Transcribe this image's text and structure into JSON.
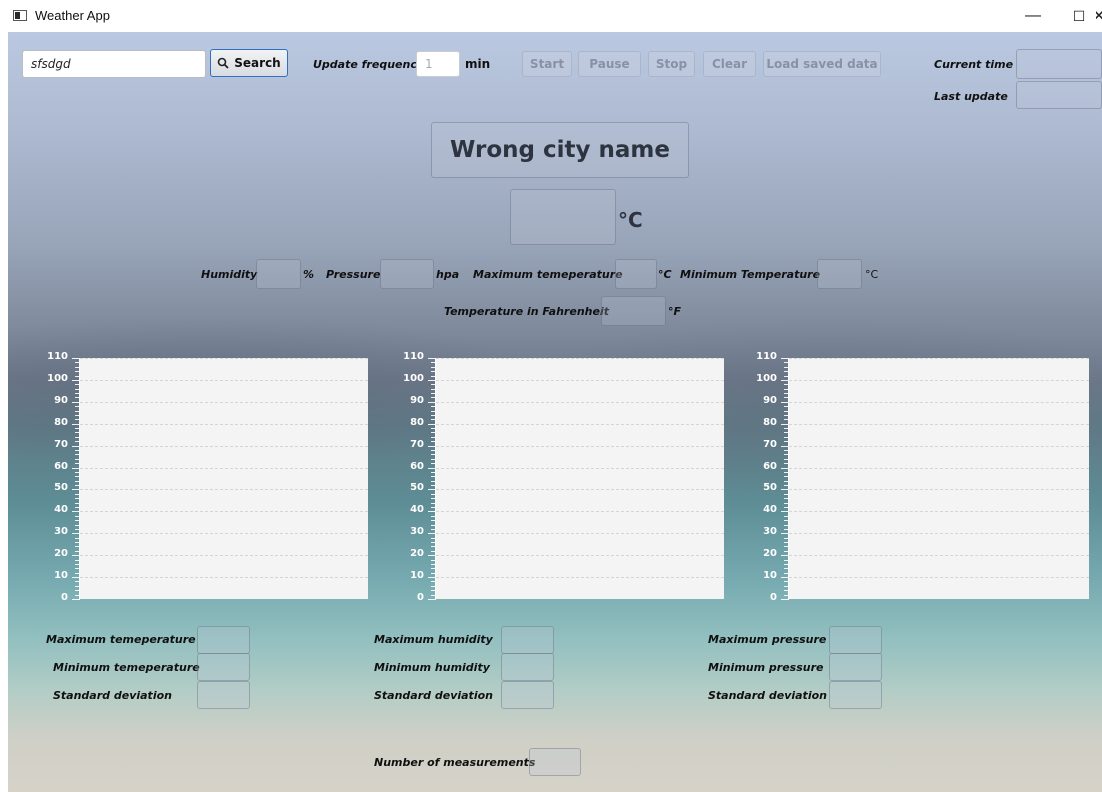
{
  "window": {
    "title": "Weather App",
    "minimize": "—",
    "maximize": "☐",
    "close": "✕"
  },
  "toolbar": {
    "city_value": "sfsdgd",
    "search_label": "Search",
    "update_frequency_label": "Update frequency",
    "frequency_value": "1",
    "min_label": "min",
    "start_label": "Start",
    "pause_label": "Pause",
    "stop_label": "Stop",
    "clear_label": "Clear",
    "load_label": "Load saved data",
    "current_time_label": "Current time",
    "last_update_label": "Last update"
  },
  "weather": {
    "city_name": "Wrong city name",
    "temp_unit": "°C",
    "humidity_label": "Humidity",
    "humidity_unit": "%",
    "pressure_label": "Pressure",
    "pressure_unit": "hpa",
    "max_temp_label": "Maximum temeperature",
    "max_temp_unit": "°C",
    "min_temp_label": "Minimum Temperature",
    "min_temp_unit": "°C",
    "fahrenheit_label": "Temperature in Fahrenheit",
    "fahrenheit_unit": "°F"
  },
  "chart_data": [
    {
      "type": "line",
      "series": [],
      "ylim": [
        0,
        110
      ],
      "yticks": [
        "110",
        "100",
        "90",
        "80",
        "70",
        "60",
        "50",
        "40",
        "30",
        "20",
        "10",
        "0"
      ],
      "grid": true
    },
    {
      "type": "line",
      "series": [],
      "ylim": [
        0,
        110
      ],
      "yticks": [
        "110",
        "100",
        "90",
        "80",
        "70",
        "60",
        "50",
        "40",
        "30",
        "20",
        "10",
        "0"
      ],
      "grid": true
    },
    {
      "type": "line",
      "series": [],
      "ylim": [
        0,
        110
      ],
      "yticks": [
        "110",
        "100",
        "90",
        "80",
        "70",
        "60",
        "50",
        "40",
        "30",
        "20",
        "10",
        "0"
      ],
      "grid": true
    }
  ],
  "stats": {
    "temperature": {
      "max_label": "Maximum temeperature",
      "min_label": "Minimum temeperature",
      "std_label": "Standard deviation"
    },
    "humidity": {
      "max_label": "Maximum humidity",
      "min_label": "Minimum humidity",
      "std_label": "Standard deviation"
    },
    "pressure": {
      "max_label": "Maximum pressure",
      "min_label": "Minimum pressure",
      "std_label": "Standard deviation"
    },
    "count_label": "Number of measurements"
  }
}
